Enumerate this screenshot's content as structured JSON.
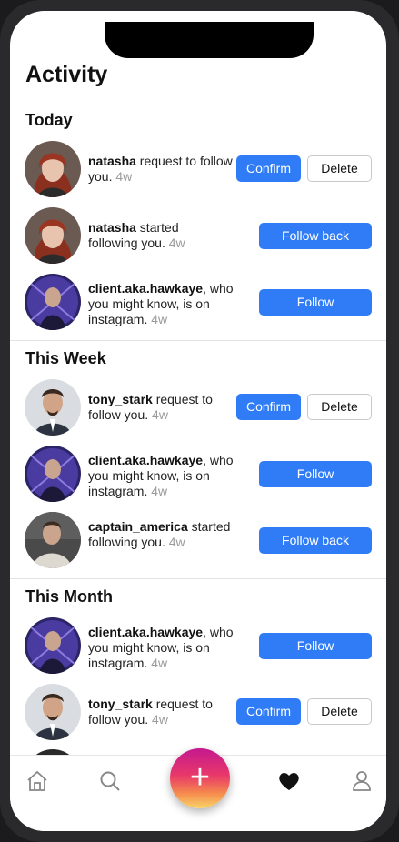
{
  "screen": {
    "title": "Activity"
  },
  "sections": [
    {
      "title": "Today",
      "items": [
        {
          "user": "natasha",
          "text": " request to follow you.",
          "time": "4w",
          "avatar": "natasha-avatar",
          "buttons": [
            "Confirm",
            "Delete"
          ]
        },
        {
          "user": "natasha",
          "text": " started following you.",
          "time": "4w",
          "avatar": "natasha-avatar",
          "buttons": [
            "Follow back"
          ]
        },
        {
          "user": "client.aka.hawkaye",
          "text": ", who you might know, is on instagram.",
          "time": "4w",
          "avatar": "hawkeye-avatar",
          "buttons": [
            "Follow"
          ]
        }
      ]
    },
    {
      "title": "This Week",
      "items": [
        {
          "user": "tony_stark",
          "text": " request to follow you.",
          "time": "4w",
          "avatar": "tony-avatar",
          "buttons": [
            "Confirm",
            "Delete"
          ]
        },
        {
          "user": "client.aka.hawkaye",
          "text": ", who you might know, is on instagram.",
          "time": "4w",
          "avatar": "hawkeye-avatar",
          "buttons": [
            "Follow"
          ]
        },
        {
          "user": "captain_america",
          "text": " started following you.",
          "time": "4w",
          "avatar": "captain-avatar",
          "buttons": [
            "Follow back"
          ]
        }
      ]
    },
    {
      "title": "This Month",
      "items": [
        {
          "user": "client.aka.hawkaye",
          "text": ", who you might know, is on instagram.",
          "time": "4w",
          "avatar": "hawkeye-avatar",
          "buttons": [
            "Follow"
          ]
        },
        {
          "user": "tony_stark",
          "text": " request to follow you.",
          "time": "4w",
          "avatar": "tony-avatar",
          "buttons": [
            "Confirm",
            "Delete"
          ]
        }
      ]
    }
  ],
  "tabbar": {
    "tabs": [
      {
        "icon": "home-icon"
      },
      {
        "icon": "search-icon"
      },
      {
        "icon": "add-icon",
        "label": "+"
      },
      {
        "icon": "heart-icon",
        "active": true
      },
      {
        "icon": "profile-icon"
      }
    ]
  },
  "colors": {
    "accent": "#2f7cf6",
    "muted": "#9a9a9a"
  }
}
